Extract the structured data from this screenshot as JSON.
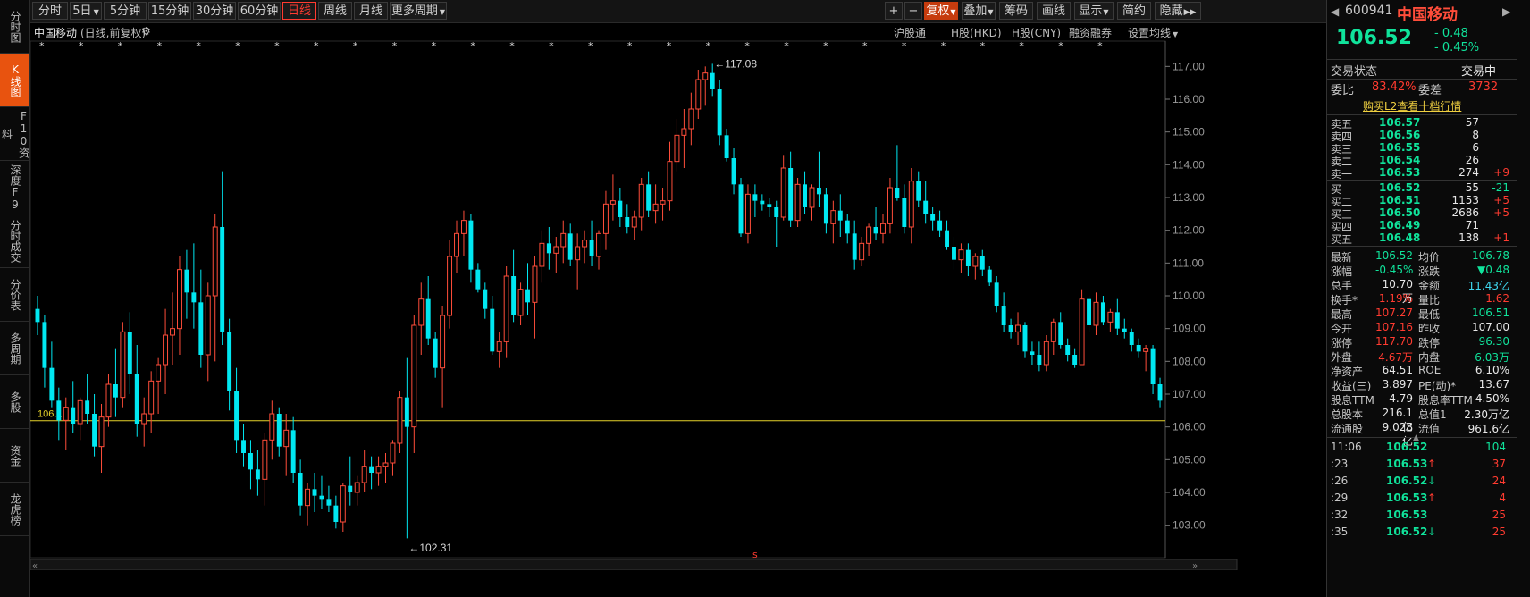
{
  "leftbar": {
    "items": [
      {
        "label": "分时图"
      },
      {
        "label": "K线图"
      },
      {
        "label": "F10资料"
      },
      {
        "label": "深度F9"
      },
      {
        "label": "分时成交"
      },
      {
        "label": "分价表"
      },
      {
        "label": "多周期"
      },
      {
        "label": "多股"
      },
      {
        "label": "资金"
      },
      {
        "label": "龙虎榜"
      }
    ]
  },
  "toolbar": {
    "periods": [
      "分时",
      "5日",
      "5分钟",
      "15分钟",
      "30分钟",
      "60分钟",
      "日线",
      "周线",
      "月线",
      "更多周期"
    ],
    "active_period": "日线",
    "right": [
      "+",
      "−",
      "复权",
      "叠加",
      "筹码",
      "画线",
      "显示",
      "简约",
      "隐藏"
    ]
  },
  "chart_header": {
    "name": "中国移动",
    "mode": "(日线,前复权)",
    "links": [
      "沪股通",
      "H股(HKD)",
      "H股(CNY)",
      "融资融券",
      "设置均线"
    ]
  },
  "chart_data": {
    "type": "candlestick",
    "ylim": [
      102.5,
      117.5
    ],
    "yticks": [
      "117.00",
      "116.00",
      "115.00",
      "114.00",
      "113.00",
      "112.00",
      "111.00",
      "110.00",
      "109.00",
      "108.00",
      "107.00",
      "106.00",
      "105.00",
      "104.00",
      "103.00"
    ],
    "ref_line": {
      "value": 106.19,
      "label": "106.19"
    },
    "high_marker": {
      "value": 117.08,
      "label": "117.08"
    },
    "low_marker": {
      "value": 102.31,
      "label": "102.31"
    },
    "candles": [
      [
        109.6,
        110.0,
        108.8,
        109.2
      ],
      [
        109.2,
        109.4,
        107.2,
        107.8
      ],
      [
        107.8,
        108.6,
        106.6,
        106.8
      ],
      [
        106.8,
        107.2,
        105.6,
        106.2
      ],
      [
        106.2,
        106.9,
        105.3,
        106.6
      ],
      [
        106.6,
        107.4,
        105.8,
        106.1
      ],
      [
        106.1,
        106.9,
        105.6,
        106.8
      ],
      [
        106.8,
        107.6,
        106.1,
        106.4
      ],
      [
        106.4,
        107.0,
        105.1,
        105.4
      ],
      [
        105.4,
        106.7,
        104.6,
        106.3
      ],
      [
        106.3,
        107.6,
        106.0,
        107.3
      ],
      [
        107.3,
        108.4,
        106.3,
        106.9
      ],
      [
        106.9,
        109.2,
        106.6,
        108.9
      ],
      [
        108.9,
        109.5,
        107.0,
        107.6
      ],
      [
        107.6,
        108.5,
        105.7,
        106.1
      ],
      [
        106.1,
        106.9,
        105.4,
        106.4
      ],
      [
        106.4,
        107.7,
        105.8,
        107.4
      ],
      [
        107.4,
        108.1,
        106.4,
        107.9
      ],
      [
        107.9,
        109.6,
        107.0,
        108.8
      ],
      [
        108.8,
        110.1,
        107.9,
        109.0
      ],
      [
        109.0,
        111.2,
        108.2,
        110.8
      ],
      [
        110.8,
        111.4,
        109.3,
        110.1
      ],
      [
        110.1,
        111.6,
        109.0,
        109.8
      ],
      [
        109.8,
        110.8,
        107.8,
        108.2
      ],
      [
        108.2,
        110.4,
        107.4,
        110.0
      ],
      [
        110.0,
        112.5,
        108.0,
        112.1
      ],
      [
        112.1,
        113.8,
        108.5,
        108.9
      ],
      [
        108.9,
        109.3,
        106.5,
        107.1
      ],
      [
        107.1,
        107.8,
        105.2,
        105.6
      ],
      [
        105.6,
        106.1,
        104.8,
        105.2
      ],
      [
        105.2,
        105.6,
        104.1,
        104.7
      ],
      [
        104.7,
        105.3,
        103.9,
        104.4
      ],
      [
        104.4,
        105.8,
        103.6,
        105.6
      ],
      [
        105.6,
        106.8,
        105.0,
        106.4
      ],
      [
        106.4,
        106.6,
        105.1,
        105.4
      ],
      [
        105.4,
        106.4,
        104.5,
        105.9
      ],
      [
        105.9,
        106.3,
        104.3,
        104.6
      ],
      [
        104.6,
        105.0,
        103.3,
        103.6
      ],
      [
        103.6,
        104.3,
        103.0,
        104.1
      ],
      [
        104.1,
        104.6,
        103.4,
        103.9
      ],
      [
        103.9,
        104.5,
        103.5,
        103.8
      ],
      [
        103.8,
        104.2,
        103.4,
        103.6
      ],
      [
        103.6,
        103.9,
        102.9,
        103.1
      ],
      [
        103.1,
        104.3,
        102.8,
        104.2
      ],
      [
        104.2,
        105.1,
        103.6,
        104.0
      ],
      [
        104.0,
        104.5,
        103.6,
        104.3
      ],
      [
        104.3,
        105.3,
        104.0,
        104.8
      ],
      [
        104.8,
        105.1,
        104.1,
        104.6
      ],
      [
        104.6,
        105.1,
        104.2,
        104.8
      ],
      [
        104.8,
        105.2,
        104.3,
        104.9
      ],
      [
        104.9,
        105.6,
        104.5,
        105.5
      ],
      [
        105.5,
        107.1,
        105.2,
        106.9
      ],
      [
        106.9,
        108.1,
        102.6,
        106.0
      ],
      [
        106.0,
        109.4,
        105.2,
        109.1
      ],
      [
        109.1,
        110.4,
        108.2,
        109.9
      ],
      [
        109.9,
        110.6,
        108.5,
        108.7
      ],
      [
        108.7,
        108.9,
        107.5,
        107.8
      ],
      [
        107.8,
        109.7,
        106.6,
        109.4
      ],
      [
        109.4,
        111.7,
        109.0,
        111.2
      ],
      [
        111.2,
        112.3,
        110.7,
        111.9
      ],
      [
        111.9,
        112.6,
        111.2,
        112.3
      ],
      [
        112.3,
        112.5,
        110.4,
        110.8
      ],
      [
        110.8,
        111.0,
        110.1,
        110.2
      ],
      [
        110.2,
        110.4,
        109.3,
        109.6
      ],
      [
        109.6,
        110.0,
        108.2,
        108.3
      ],
      [
        108.3,
        108.9,
        107.8,
        108.6
      ],
      [
        108.6,
        110.9,
        108.1,
        110.6
      ],
      [
        110.6,
        111.4,
        109.2,
        109.4
      ],
      [
        109.4,
        110.4,
        109.1,
        110.2
      ],
      [
        110.2,
        111.0,
        109.4,
        109.8
      ],
      [
        109.8,
        111.2,
        108.7,
        110.9
      ],
      [
        110.9,
        112.0,
        110.4,
        111.6
      ],
      [
        111.6,
        112.1,
        110.8,
        111.3
      ],
      [
        111.3,
        111.8,
        110.7,
        111.5
      ],
      [
        111.5,
        112.3,
        111.0,
        111.9
      ],
      [
        111.9,
        112.2,
        110.9,
        111.1
      ],
      [
        111.1,
        111.9,
        110.2,
        111.5
      ],
      [
        111.5,
        112.0,
        111.0,
        111.7
      ],
      [
        111.7,
        112.3,
        110.9,
        111.2
      ],
      [
        111.2,
        112.0,
        110.8,
        111.9
      ],
      [
        111.9,
        113.2,
        111.4,
        112.8
      ],
      [
        112.8,
        113.7,
        112.3,
        112.9
      ],
      [
        112.9,
        113.3,
        112.1,
        112.4
      ],
      [
        112.4,
        112.8,
        111.9,
        112.1
      ],
      [
        112.1,
        112.6,
        111.7,
        112.4
      ],
      [
        112.4,
        113.6,
        112.0,
        113.4
      ],
      [
        113.4,
        113.8,
        112.4,
        112.6
      ],
      [
        112.6,
        113.4,
        112.2,
        112.8
      ],
      [
        112.8,
        113.3,
        112.3,
        112.9
      ],
      [
        112.9,
        114.7,
        112.6,
        114.1
      ],
      [
        114.1,
        115.4,
        113.8,
        114.9
      ],
      [
        114.9,
        115.7,
        113.9,
        115.1
      ],
      [
        115.1,
        116.2,
        114.6,
        115.7
      ],
      [
        115.7,
        116.9,
        115.4,
        116.6
      ],
      [
        116.6,
        117.0,
        115.8,
        116.8
      ],
      [
        116.8,
        117.08,
        116.1,
        116.3
      ],
      [
        116.3,
        116.6,
        114.6,
        114.9
      ],
      [
        114.9,
        115.1,
        114.1,
        114.2
      ],
      [
        114.2,
        114.5,
        113.1,
        113.4
      ],
      [
        113.4,
        113.6,
        111.8,
        111.9
      ],
      [
        111.9,
        113.4,
        111.6,
        113.1
      ],
      [
        113.1,
        113.4,
        112.4,
        112.9
      ],
      [
        112.9,
        113.1,
        112.6,
        112.8
      ],
      [
        112.8,
        113.0,
        112.4,
        112.7
      ],
      [
        112.7,
        112.9,
        111.5,
        112.4
      ],
      [
        112.4,
        114.3,
        112.3,
        113.9
      ],
      [
        113.9,
        114.4,
        112.1,
        112.3
      ],
      [
        112.3,
        113.6,
        112.1,
        113.4
      ],
      [
        113.4,
        113.8,
        112.5,
        112.7
      ],
      [
        112.7,
        113.4,
        112.3,
        113.3
      ],
      [
        113.3,
        114.4,
        112.7,
        113.1
      ],
      [
        113.1,
        113.3,
        111.9,
        112.2
      ],
      [
        112.2,
        112.9,
        111.6,
        112.6
      ],
      [
        112.6,
        113.1,
        111.8,
        112.3
      ],
      [
        112.3,
        112.5,
        111.6,
        111.9
      ],
      [
        111.9,
        112.3,
        110.8,
        111.1
      ],
      [
        111.1,
        111.8,
        110.9,
        111.6
      ],
      [
        111.6,
        112.2,
        111.2,
        112.1
      ],
      [
        112.1,
        112.7,
        111.7,
        111.9
      ],
      [
        111.9,
        112.5,
        111.6,
        112.2
      ],
      [
        112.2,
        113.6,
        111.9,
        113.3
      ],
      [
        113.3,
        114.6,
        112.9,
        113.0
      ],
      [
        113.0,
        113.4,
        111.9,
        112.1
      ],
      [
        112.1,
        113.9,
        111.6,
        113.5
      ],
      [
        113.5,
        113.8,
        112.7,
        112.9
      ],
      [
        112.9,
        113.5,
        112.2,
        112.5
      ],
      [
        112.5,
        112.7,
        112.0,
        112.3
      ],
      [
        112.3,
        112.6,
        111.8,
        112.0
      ],
      [
        112.0,
        112.3,
        111.4,
        111.5
      ],
      [
        111.5,
        111.8,
        110.8,
        111.1
      ],
      [
        111.1,
        111.6,
        110.7,
        111.4
      ],
      [
        111.4,
        111.6,
        110.6,
        110.9
      ],
      [
        110.9,
        111.3,
        110.5,
        111.2
      ],
      [
        111.2,
        111.4,
        110.6,
        110.8
      ],
      [
        110.8,
        110.9,
        110.3,
        110.4
      ],
      [
        110.4,
        110.6,
        109.5,
        109.7
      ],
      [
        109.7,
        110.1,
        108.9,
        109.1
      ],
      [
        109.1,
        109.3,
        108.7,
        108.9
      ],
      [
        108.9,
        109.5,
        108.5,
        109.1
      ],
      [
        109.1,
        109.2,
        108.1,
        108.3
      ],
      [
        108.3,
        108.6,
        107.9,
        108.2
      ],
      [
        108.2,
        108.6,
        107.7,
        107.9
      ],
      [
        107.9,
        108.8,
        107.7,
        108.6
      ],
      [
        108.6,
        109.3,
        108.2,
        109.2
      ],
      [
        109.2,
        109.5,
        108.4,
        108.5
      ],
      [
        108.5,
        108.7,
        108.0,
        108.2
      ],
      [
        108.2,
        108.4,
        107.8,
        107.9
      ],
      [
        107.9,
        110.2,
        107.9,
        109.9
      ],
      [
        109.9,
        110.0,
        108.9,
        109.1
      ],
      [
        109.1,
        110.1,
        108.8,
        109.8
      ],
      [
        109.8,
        110.0,
        109.1,
        109.2
      ],
      [
        109.2,
        109.6,
        108.9,
        109.5
      ],
      [
        109.5,
        109.9,
        108.8,
        109.0
      ],
      [
        109.0,
        109.3,
        108.7,
        108.9
      ],
      [
        108.9,
        109.0,
        108.3,
        108.5
      ],
      [
        108.5,
        108.7,
        108.1,
        108.3
      ],
      [
        108.3,
        108.5,
        107.7,
        108.4
      ],
      [
        108.4,
        108.5,
        107.0,
        107.3
      ],
      [
        107.3,
        107.5,
        106.6,
        106.8
      ]
    ],
    "markers_count": 28
  },
  "quote": {
    "code": "600941",
    "name": "中国移动",
    "price": "106.52",
    "change": "- 0.48",
    "change_pct": "- 0.45%",
    "status_label": "交易状态",
    "status": "交易中",
    "weibi_label": "委比",
    "weibi": "83.42%",
    "weicha_label": "委差",
    "weicha": "3732",
    "l2_link": "购买L2查看十档行情",
    "asks": [
      {
        "label": "卖五",
        "price": "106.57",
        "vol": "57",
        "chg": ""
      },
      {
        "label": "卖四",
        "price": "106.56",
        "vol": "8",
        "chg": ""
      },
      {
        "label": "卖三",
        "price": "106.55",
        "vol": "6",
        "chg": ""
      },
      {
        "label": "卖二",
        "price": "106.54",
        "vol": "26",
        "chg": ""
      },
      {
        "label": "卖一",
        "price": "106.53",
        "vol": "274",
        "chg": "+9"
      }
    ],
    "bids": [
      {
        "label": "买一",
        "price": "106.52",
        "vol": "55",
        "chg": "-21"
      },
      {
        "label": "买二",
        "price": "106.51",
        "vol": "1153",
        "chg": "+5"
      },
      {
        "label": "买三",
        "price": "106.50",
        "vol": "2686",
        "chg": "+5"
      },
      {
        "label": "买四",
        "price": "106.49",
        "vol": "71",
        "chg": ""
      },
      {
        "label": "买五",
        "price": "106.48",
        "vol": "138",
        "chg": "+1"
      }
    ],
    "stats": [
      [
        "最新",
        "106.52",
        "均价",
        "106.78"
      ],
      [
        "涨幅",
        "-0.45%",
        "涨跌",
        "▼0.48"
      ],
      [
        "总手",
        "10.70万",
        "金额",
        "11.43亿"
      ],
      [
        "换手*",
        "1.19%",
        "量比",
        "1.62"
      ],
      [
        "最高",
        "107.27",
        "最低",
        "106.51"
      ],
      [
        "今开",
        "107.16",
        "昨收",
        "107.00"
      ],
      [
        "涨停",
        "117.70",
        "跌停",
        "96.30"
      ],
      [
        "外盘",
        "4.67万",
        "内盘",
        "6.03万"
      ],
      [
        "净资产",
        "64.51",
        "ROE",
        "6.10%"
      ],
      [
        "收益(三)",
        "3.897",
        "PE(动)*",
        "13.67"
      ],
      [
        "股息TTM",
        "4.79",
        "股息率TTM",
        "4.50%"
      ],
      [
        "总股本",
        "216.1亿",
        "总值1",
        "2.30万亿"
      ],
      [
        "流通股",
        "9.028亿",
        "流值",
        "961.6亿"
      ]
    ],
    "ticks": [
      {
        "time": "11:06",
        "price": "106.52",
        "arrow": "",
        "vol": "104"
      },
      {
        "time": ":23",
        "price": "106.53",
        "arrow": "↑",
        "vol": "37"
      },
      {
        "time": ":26",
        "price": "106.52",
        "arrow": "↓",
        "vol": "24"
      },
      {
        "time": ":29",
        "price": "106.53",
        "arrow": "↑",
        "vol": "4"
      },
      {
        "time": ":32",
        "price": "106.53",
        "arrow": "",
        "vol": "25"
      },
      {
        "time": ":35",
        "price": "106.52",
        "arrow": "↓",
        "vol": "25"
      }
    ]
  }
}
